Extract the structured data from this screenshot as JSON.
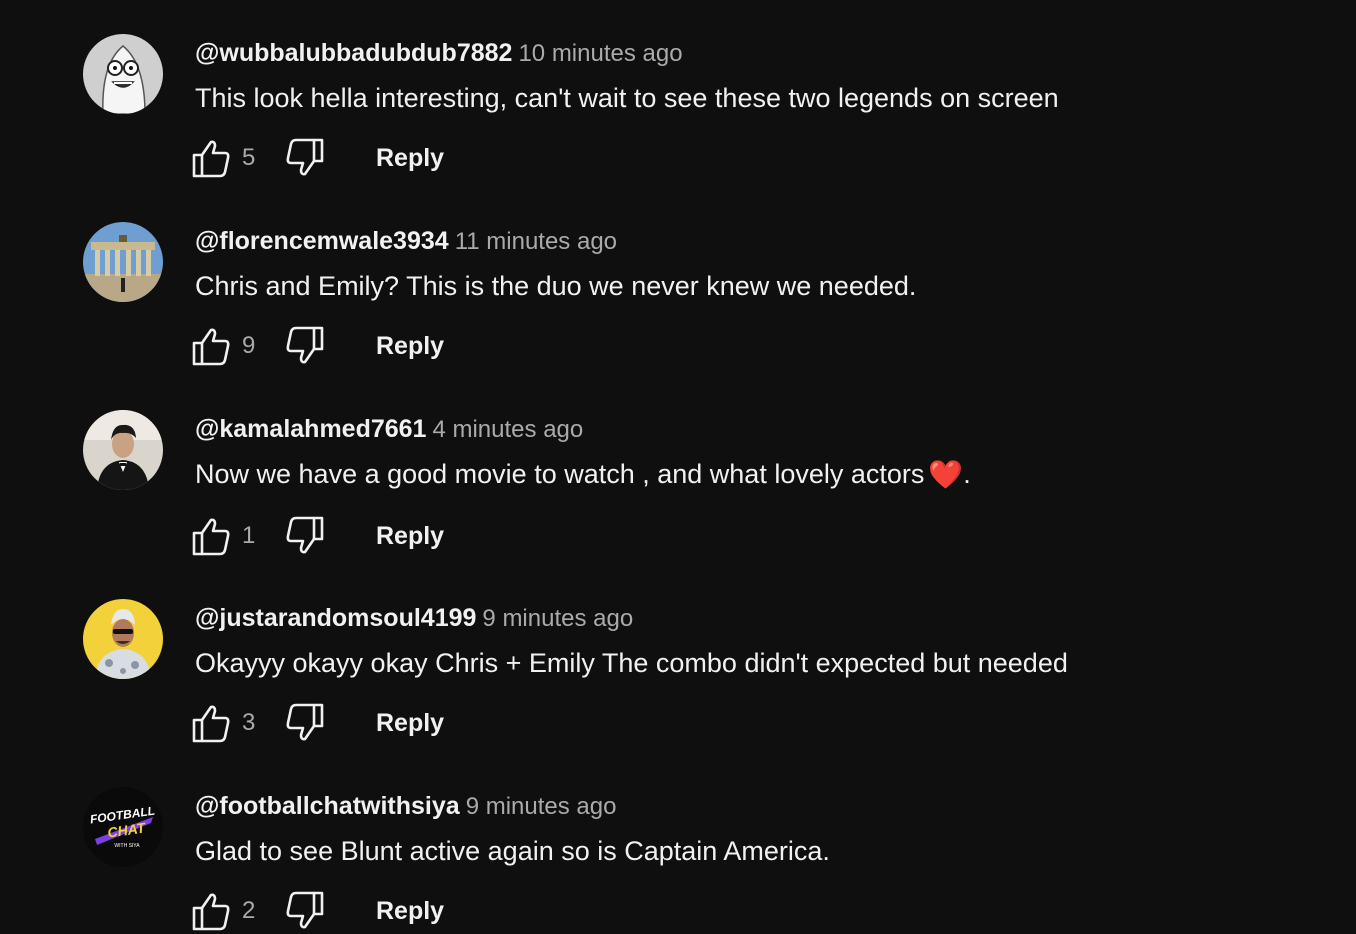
{
  "comments": [
    {
      "author": "@wubbalubbadubdub7882",
      "time": "10 minutes ago",
      "text": "This look hella interesting, can't wait to see these two legends on screen",
      "likes": "5",
      "reply_label": "Reply",
      "avatar_icon": "cartoon-character-avatar"
    },
    {
      "author": "@florencemwale3934",
      "time": "11 minutes ago",
      "text": "Chris and Emily? This is the duo we never knew we needed.",
      "likes": "9",
      "reply_label": "Reply",
      "avatar_icon": "landmark-photo-avatar"
    },
    {
      "author": "@kamalahmed7661",
      "time": "4 minutes ago",
      "text": "Now we have a good movie to watch , and what lovely actors",
      "text_end": ".",
      "emoji": "❤️",
      "likes": "1",
      "reply_label": "Reply",
      "avatar_icon": "person-photo-avatar"
    },
    {
      "author": "@justarandomsoul4199",
      "time": "9 minutes ago",
      "text": "Okayyy okayy okay Chris + Emily The combo didn't expected but needed",
      "likes": "3",
      "reply_label": "Reply",
      "avatar_icon": "person-yellow-background-avatar"
    },
    {
      "author": "@footballchatwithsiya",
      "time": "9 minutes ago",
      "text": "Glad to see Blunt active again so is Captain America.",
      "likes": "2",
      "reply_label": "Reply",
      "avatar_icon": "football-chat-logo-avatar",
      "avatar_logo_lines": [
        "FOOTBALL",
        "CHAT",
        "WITH SIYA"
      ]
    }
  ],
  "colors": {
    "background": "#0f0f0f",
    "primary_text": "#f1f1f1",
    "secondary_text": "#aaaaaa",
    "heart": "#e5322d"
  }
}
